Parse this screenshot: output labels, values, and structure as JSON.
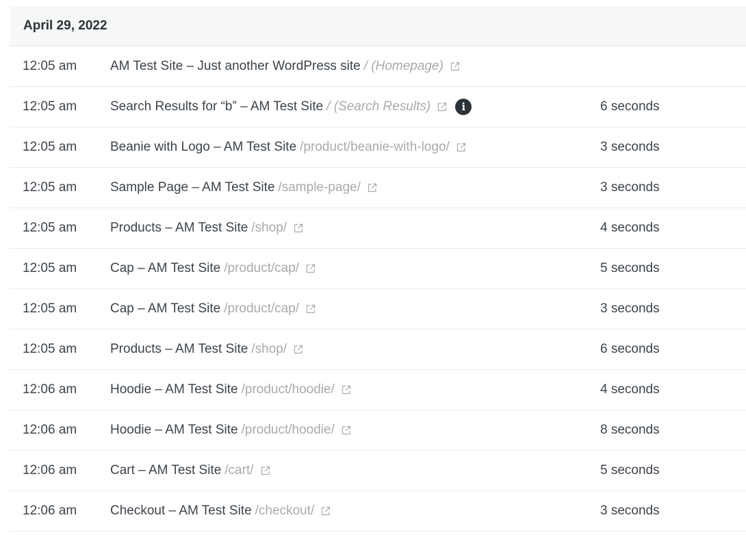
{
  "date_header": "April 29, 2022",
  "rows": [
    {
      "time": "12:05 am",
      "title": "AM Test Site – Just another WordPress site",
      "path": "/ (Homepage)",
      "path_italic": true,
      "info": false,
      "duration": ""
    },
    {
      "time": "12:05 am",
      "title": "Search Results for “b” – AM Test Site",
      "path": "/ (Search Results)",
      "path_italic": true,
      "info": true,
      "duration": "6 seconds"
    },
    {
      "time": "12:05 am",
      "title": "Beanie with Logo – AM Test Site",
      "path": "/product/beanie-with-logo/",
      "path_italic": false,
      "info": false,
      "duration": "3 seconds"
    },
    {
      "time": "12:05 am",
      "title": "Sample Page – AM Test Site",
      "path": "/sample-page/",
      "path_italic": false,
      "info": false,
      "duration": "3 seconds"
    },
    {
      "time": "12:05 am",
      "title": "Products – AM Test Site",
      "path": "/shop/",
      "path_italic": false,
      "info": false,
      "duration": "4 seconds"
    },
    {
      "time": "12:05 am",
      "title": "Cap – AM Test Site",
      "path": "/product/cap/",
      "path_italic": false,
      "info": false,
      "duration": "5 seconds"
    },
    {
      "time": "12:05 am",
      "title": "Cap – AM Test Site",
      "path": "/product/cap/",
      "path_italic": false,
      "info": false,
      "duration": "3 seconds"
    },
    {
      "time": "12:05 am",
      "title": "Products – AM Test Site",
      "path": "/shop/",
      "path_italic": false,
      "info": false,
      "duration": "6 seconds"
    },
    {
      "time": "12:06 am",
      "title": "Hoodie – AM Test Site",
      "path": "/product/hoodie/",
      "path_italic": false,
      "info": false,
      "duration": "4 seconds"
    },
    {
      "time": "12:06 am",
      "title": "Hoodie – AM Test Site",
      "path": "/product/hoodie/",
      "path_italic": false,
      "info": false,
      "duration": "8 seconds"
    },
    {
      "time": "12:06 am",
      "title": "Cart – AM Test Site",
      "path": "/cart/",
      "path_italic": false,
      "info": false,
      "duration": "5 seconds"
    },
    {
      "time": "12:06 am",
      "title": "Checkout – AM Test Site",
      "path": "/checkout/",
      "path_italic": false,
      "info": false,
      "duration": "3 seconds"
    }
  ],
  "icons": {
    "external_link": "external-link-icon",
    "info": "info-icon",
    "info_glyph": "i"
  }
}
